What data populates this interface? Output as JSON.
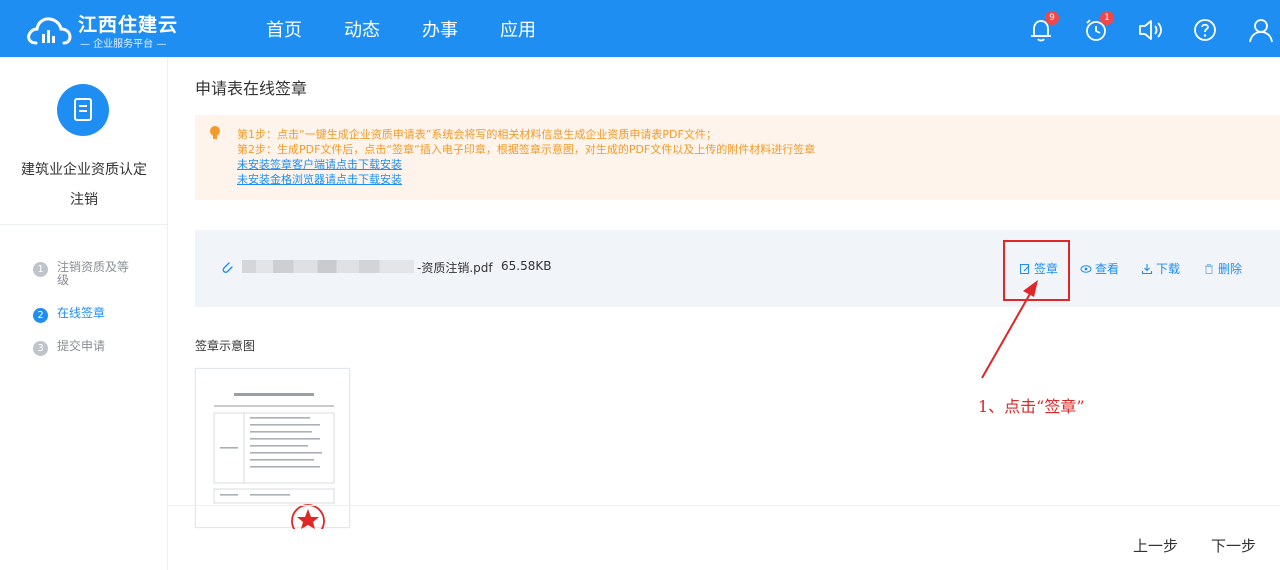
{
  "header": {
    "logo_title": "江西住建云",
    "logo_subtitle": "— 企业服务平台 —",
    "nav": [
      "首页",
      "动态",
      "办事",
      "应用"
    ],
    "notification_count": "9",
    "alarm_count": "1"
  },
  "sidebar": {
    "title_line1": "建筑业企业资质认定",
    "title_line2": "注销",
    "steps": [
      {
        "num": "1",
        "label": "注销资质及等级"
      },
      {
        "num": "2",
        "label": "在线签章"
      },
      {
        "num": "3",
        "label": "提交申请"
      }
    ]
  },
  "main": {
    "page_title": "申请表在线签章",
    "notice": {
      "step1": "第1步：点击“一键生成企业资质申请表”系统会将写的相关材料信息生成企业资质申请表PDF文件；",
      "step2": "第2步：生成PDF文件后，点击“签章”插入电子印章，根据签章示意图，对生成的PDF文件以及上传的附件材料进行签章",
      "link1": "未安装签章客户端请点击下载安装",
      "link2": "未安装金格浏览器请点击下载安装"
    },
    "file": {
      "name": "-资质注销.pdf",
      "size": "65.58KB",
      "actions": [
        "签章",
        "查看",
        "下载",
        "删除"
      ]
    },
    "sample_label": "签章示意图",
    "annotation": "1、点击“签章”"
  },
  "footer": {
    "prev": "上一步",
    "next": "下一步"
  },
  "colors": {
    "primary": "#1f8ef3",
    "notice_bg": "#fef4ec",
    "notice_text": "#f39a2a",
    "annotation_red": "#e02727"
  }
}
